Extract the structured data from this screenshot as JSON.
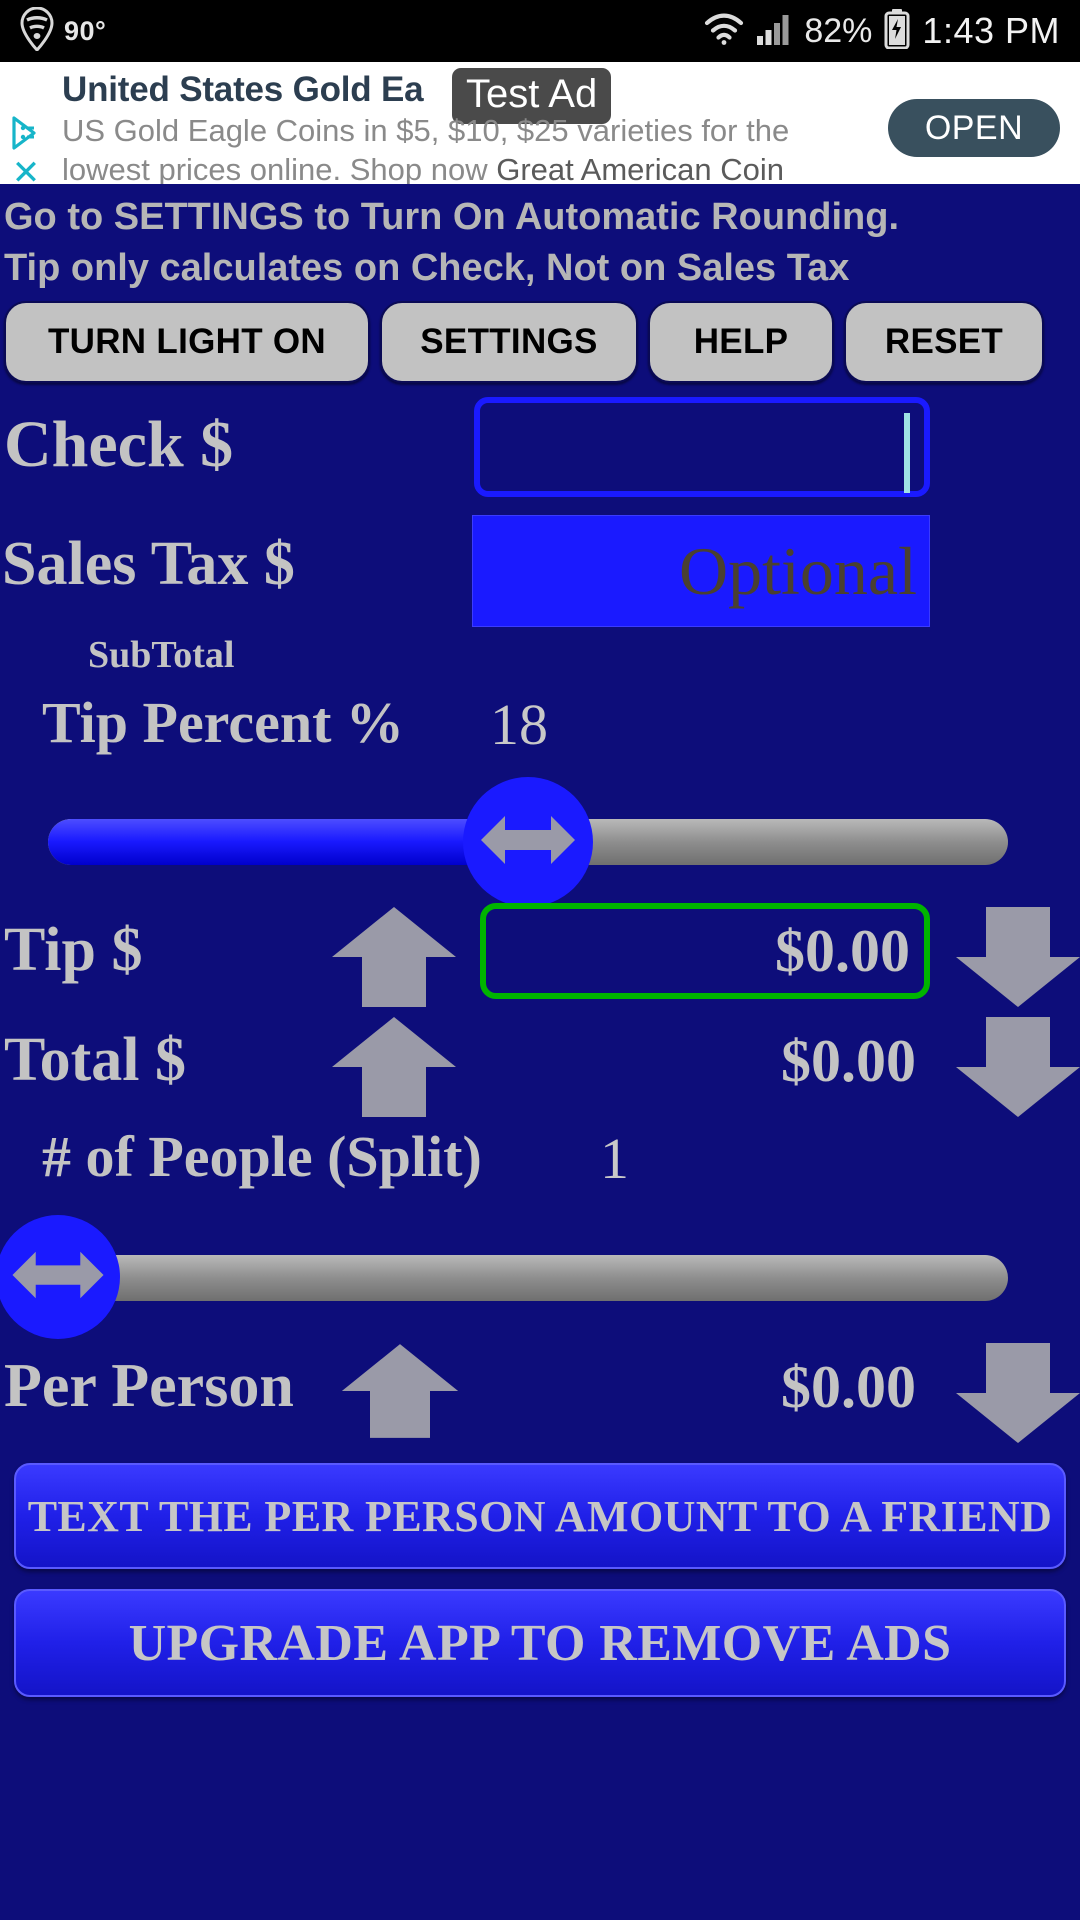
{
  "status_bar": {
    "weather_icon": "location-pin-icon",
    "temperature": "90°",
    "wifi_icon": "wifi-icon",
    "signal_icon": "cell-signal-icon",
    "battery_percent": "82%",
    "battery_icon": "battery-charging-icon",
    "time": "1:43 PM"
  },
  "ad": {
    "title": "United States Gold Ea",
    "badge": "Test Ad",
    "body_line1": "US Gold Eagle Coins in $5, $10, $25 varieties for the",
    "body_line2_a": "lowest prices online. Shop now ",
    "body_line2_b": "Great American Coin",
    "adchoices_icon": "adchoices-icon",
    "close_icon": "close-icon",
    "open_label": "OPEN"
  },
  "notice": {
    "line1": "Go to SETTINGS to Turn On Automatic Rounding.",
    "line2": "Tip only calculates on Check, Not on Sales Tax"
  },
  "toolbar": {
    "light_label": "TURN LIGHT ON",
    "settings_label": "SETTINGS",
    "help_label": "HELP",
    "reset_label": "RESET"
  },
  "check": {
    "label": "Check $",
    "value": "",
    "placeholder": ""
  },
  "sales_tax": {
    "label": "Sales Tax $",
    "value": "",
    "placeholder": "Optional"
  },
  "subtotal": {
    "label": "SubTotal",
    "value": ""
  },
  "tip_percent": {
    "label": "Tip Percent %",
    "value": "18",
    "slider_fill_percent": 50,
    "up_icon": "arrow-up-icon",
    "down_icon": "arrow-down-icon",
    "thumb_icon": "left-right-arrow-icon"
  },
  "tip": {
    "label": "Tip $",
    "value": "$0.00",
    "up_icon": "arrow-up-icon",
    "down_icon": "arrow-down-icon"
  },
  "total": {
    "label": "Total $",
    "value": "$0.00",
    "up_icon": "arrow-up-icon",
    "down_icon": "arrow-down-icon"
  },
  "people": {
    "label": "# of People (Split)",
    "value": "1",
    "slider_fill_percent": 1,
    "thumb_icon": "left-right-arrow-icon"
  },
  "per_person": {
    "label": "Per Person",
    "value": "$0.00",
    "up_icon": "arrow-up-icon",
    "down_icon": "arrow-down-icon"
  },
  "actions": {
    "text_friend_label": "TEXT THE PER PERSON AMOUNT TO A FRIEND",
    "upgrade_label": "UPGRADE APP TO REMOVE ADS"
  },
  "colors": {
    "app_background": "#0d0d7a",
    "accent_blue": "#1a1aff",
    "label_gray": "#c3c3c3",
    "button_gray": "#c2c2c2",
    "tip_border_green": "#00b400",
    "arrow_gray": "#9a9aa8"
  }
}
